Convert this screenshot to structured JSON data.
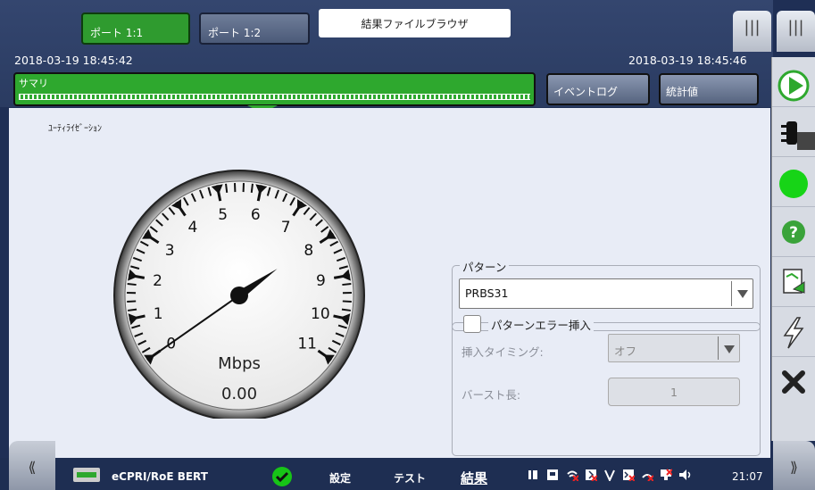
{
  "header": {
    "port_tabs": [
      {
        "label": "ポート 1:1",
        "active": true
      },
      {
        "label": "ポート 1:2",
        "active": false
      }
    ],
    "browser_tab": "結果ファイルブラウザ",
    "menu_icon_left": "|||",
    "menu_icon_right": "|||",
    "start_time": "2018-03-19 18:45:42",
    "current_time": "2018-03-19 18:45:46",
    "summary_label": "サマリ",
    "event_log_button": "イベントログ",
    "stats_button": "統計値"
  },
  "gauge": {
    "title": "ﾕｰﾃｨﾗｲｾﾞｰｼｮﾝ",
    "unit": "Mbps",
    "value_text": "0.00",
    "scale_min": 0,
    "scale_max": 11,
    "scale_labels": [
      "0",
      "1",
      "2",
      "3",
      "4",
      "5",
      "6",
      "7",
      "8",
      "9",
      "10",
      "11"
    ],
    "needle_value": 0
  },
  "pattern": {
    "legend": "パターン",
    "selected": "PRBS31"
  },
  "error_insert": {
    "legend": "パターンエラー挿入",
    "checked": false,
    "timing_label": "挿入タイミング:",
    "timing_value": "オフ",
    "burst_label": "バースト長:",
    "burst_value": "1"
  },
  "footer": {
    "app_name": "eCPRI/RoE BERT",
    "nav_settings": "設定",
    "nav_test": "テスト",
    "nav_results": "結果",
    "time": "21:07",
    "left_tab": "⟪",
    "right_tab": "⟫"
  },
  "right_panel": {
    "items": [
      "play-icon",
      "traffic-light-icon",
      "status-led-icon",
      "help-icon",
      "report-icon",
      "error-inject-icon",
      "close-icon"
    ]
  },
  "colors": {
    "accent_green": "#2ea82e",
    "content_bg": "#e8ecf6",
    "header_bg": "#2a3b61",
    "led_green": "#17d417"
  }
}
